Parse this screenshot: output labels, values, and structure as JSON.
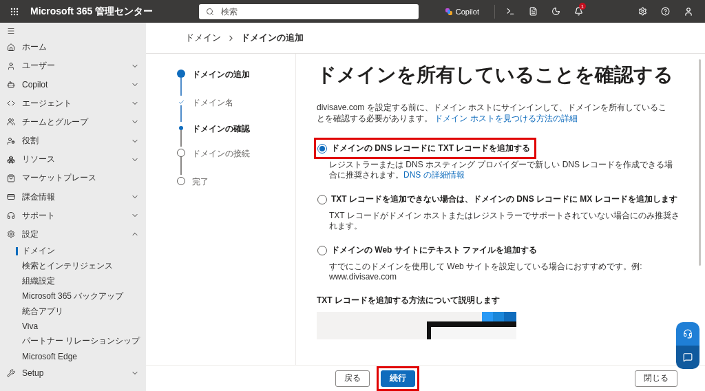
{
  "header": {
    "app_title": "Microsoft 365 管理センター",
    "search": {
      "placeholder": "検索"
    },
    "copilot": "Copilot",
    "notification_count": "1"
  },
  "sidebar": {
    "items": [
      {
        "label": "ホーム"
      },
      {
        "label": "ユーザー",
        "expanded": false
      },
      {
        "label": "Copilot",
        "expanded": false
      },
      {
        "label": "エージェント",
        "expanded": false
      },
      {
        "label": "チームとグループ",
        "expanded": false
      },
      {
        "label": "役割",
        "expanded": false
      },
      {
        "label": "リソース",
        "expanded": false
      },
      {
        "label": "マーケットプレース"
      },
      {
        "label": "課金情報",
        "expanded": false
      },
      {
        "label": "サポート",
        "expanded": false
      },
      {
        "label": "設定",
        "expanded": true,
        "children": [
          {
            "label": "ドメイン",
            "selected": true
          },
          {
            "label": "検索とインテリジェンス",
            "selected": false
          },
          {
            "label": "組織設定",
            "selected": false
          },
          {
            "label": "Microsoft 365 バックアップ",
            "selected": false
          },
          {
            "label": "統合アプリ",
            "selected": false
          },
          {
            "label": "Viva",
            "selected": false
          },
          {
            "label": "パートナー リレーションシップ",
            "selected": false
          },
          {
            "label": "Microsoft Edge",
            "selected": false
          }
        ]
      },
      {
        "label": "Setup",
        "expanded": false
      }
    ]
  },
  "breadcrumb": [
    "ドメイン",
    "ドメインの追加"
  ],
  "steps": [
    {
      "label": "ドメインの追加",
      "kind": "major",
      "completed": false,
      "current": true
    },
    {
      "label": "ドメイン名",
      "kind": "minor",
      "completed": true,
      "current": false
    },
    {
      "label": "ドメインの確認",
      "kind": "minor",
      "completed": false,
      "current": true
    },
    {
      "label": "ドメインの接続",
      "kind": "major",
      "completed": false,
      "current": false
    },
    {
      "label": "完了",
      "kind": "major",
      "completed": false,
      "current": false
    }
  ],
  "content": {
    "title": "ドメインを所有していることを確認する",
    "intro": "divisave.com を設定する前に、ドメイン ホストにサインインして、ドメインを所有していることを確認する必要があります。",
    "intro_link": "ドメイン ホストを見つける方法の詳細",
    "options": [
      {
        "label": "ドメインの DNS レコードに TXT レコードを追加する",
        "description": "レジストラーまたは DNS ホスティング プロバイダーで新しい DNS レコードを作成できる場合に推奨されます。",
        "link": "DNS の詳細情報",
        "selected": true,
        "highlighted": true
      },
      {
        "label": "TXT レコードを追加できない場合は、ドメインの DNS レコードに MX レコードを追加します",
        "description": "TXT レコードがドメイン ホストまたはレジストラーでサポートされていない場合にのみ推奨されます。",
        "selected": false,
        "highlighted": false
      },
      {
        "label": "ドメインの Web サイトにテキスト ファイルを追加する",
        "description": "すでにこのドメインを使用して Web サイトを設定している場合におすすめです。例: www.divisave.com",
        "selected": false,
        "highlighted": false
      }
    ],
    "video_heading": "TXT レコードを追加する方法について説明します"
  },
  "footer": {
    "buttons": [
      {
        "label": "戻る",
        "kind": "secondary",
        "highlighted": false
      },
      {
        "label": "続行",
        "kind": "primary",
        "highlighted": true
      }
    ],
    "close": "閉じる"
  }
}
